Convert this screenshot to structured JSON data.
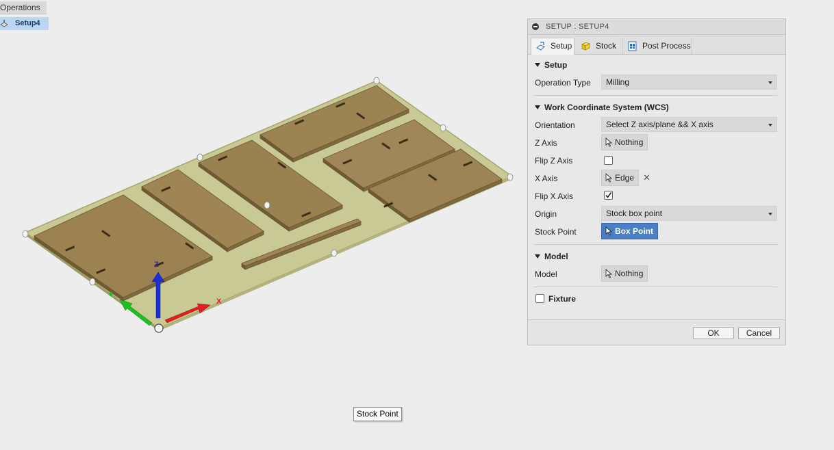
{
  "browser": {
    "operations_label": "Operations",
    "setup_node_label": "Setup4"
  },
  "viewport": {
    "axes": {
      "x": "X",
      "z": "Z"
    },
    "tooltip": "Stock Point"
  },
  "dialog": {
    "title": "SETUP : SETUP4",
    "tabs": [
      {
        "label": "Setup",
        "icon": "setup-icon"
      },
      {
        "label": "Stock",
        "icon": "stock-cube-icon"
      },
      {
        "label": "Post Process",
        "icon": "post-process-icon"
      }
    ],
    "setup_section": {
      "heading": "Setup",
      "operation_type_label": "Operation Type",
      "operation_type_value": "Milling"
    },
    "wcs_section": {
      "heading": "Work Coordinate System (WCS)",
      "orientation_label": "Orientation",
      "orientation_value": "Select Z axis/plane && X axis",
      "z_axis_label": "Z Axis",
      "z_axis_value": "Nothing",
      "flip_z_label": "Flip Z Axis",
      "flip_z_checked": false,
      "x_axis_label": "X Axis",
      "x_axis_value": "Edge",
      "flip_x_label": "Flip X Axis",
      "flip_x_checked": true,
      "origin_label": "Origin",
      "origin_value": "Stock box point",
      "stock_point_label": "Stock Point",
      "stock_point_value": "Box Point"
    },
    "model_section": {
      "heading": "Model",
      "model_label": "Model",
      "model_value": "Nothing"
    },
    "fixture_section": {
      "heading": "Fixture",
      "checked": false
    },
    "buttons": {
      "ok": "OK",
      "cancel": "Cancel"
    }
  },
  "colors": {
    "selected_button": "#4a7fc1",
    "stock_plate": "#c9c996",
    "wood_part": "#9b8250",
    "axis_x": "#e02020",
    "axis_y": "#1fbf1f",
    "axis_z": "#1c2fd6"
  }
}
